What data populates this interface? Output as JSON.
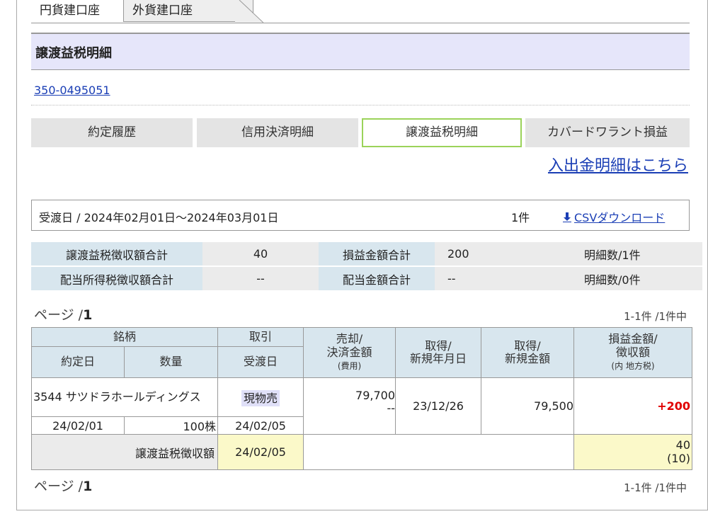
{
  "tabs": {
    "active": "円貨建口座",
    "inactive": "外貨建口座"
  },
  "section_title": "譲渡益税明細",
  "account_number": "350-0495051",
  "nav_buttons": [
    "約定履歴",
    "信用決済明細",
    "譲渡益税明細",
    "カバードワラント損益"
  ],
  "deposit_link": "入出金明細はこちら",
  "date_range": "受渡日 / 2024年02月01日〜2024年03月01日",
  "result_count": "1件",
  "csv_link": "CSVダウンロード",
  "csv_icon": "download-arrow",
  "summary": {
    "row1": {
      "label1": "譲渡益税徴収額合計",
      "value1": "40",
      "label2": "損益金額合計",
      "value2": "200",
      "count": "明細数/1件"
    },
    "row2": {
      "label1": "配当所得税徴収額合計",
      "value1": "--",
      "label2": "配当金額合計",
      "value2": "--",
      "count": "明細数/0件"
    }
  },
  "pager": {
    "prefix": "ページ /",
    "page": "1",
    "count": "1-1件 /1件中"
  },
  "table": {
    "headers": {
      "stock": "銘柄",
      "trade": "取引",
      "sale": "売却/",
      "sale2": "決済金額",
      "sale3": "(費用)",
      "acq_date": "取得/",
      "acq_date2": "新規年月日",
      "acq_amt": "取得/",
      "acq_amt2": "新規金額",
      "pl": "損益金額/",
      "pl2": "徴収額",
      "pl3": "(内 地方税)",
      "contract_date": "約定日",
      "quantity": "数量",
      "delivery_date": "受渡日"
    },
    "row": {
      "stock": "3544 サツドラホールディングス",
      "trade": "現物売",
      "sale_amount": "79,700",
      "sale_fee": "--",
      "acq_date": "23/12/26",
      "acq_amount": "79,500",
      "pl": "+200",
      "contract_date": "24/02/01",
      "quantity": "100株",
      "delivery_date": "24/02/05"
    },
    "tax_row": {
      "label": "譲渡益税徴収額",
      "date": "24/02/05",
      "tax": "40",
      "local_tax": "(10)"
    }
  },
  "colors": {
    "header_bg": "#e6e6fa",
    "label_bg": "#d8e6ee",
    "link": "#1a3eb5",
    "profit": "#e00000",
    "highlight": "#fbf9c9",
    "active_border": "#9bd35a"
  }
}
